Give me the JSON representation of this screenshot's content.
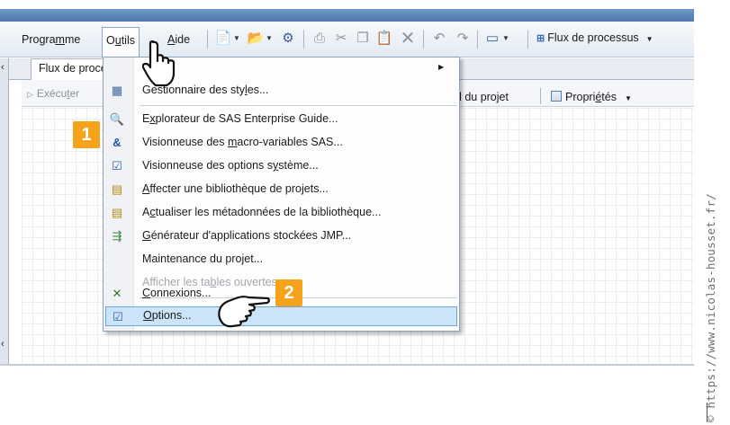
{
  "menubar": {
    "items": [
      {
        "label_pre": "Progra",
        "label_ul": "m",
        "label_post": "me"
      },
      {
        "label_pre": "O",
        "label_ul": "u",
        "label_post": "tils"
      },
      {
        "label_pre": "",
        "label_ul": "A",
        "label_post": "ide"
      }
    ],
    "toolbar_icons": [
      "new-icon",
      "open-icon",
      "sas-server-icon",
      "print-icon",
      "cut-icon",
      "copy-icon",
      "paste-icon",
      "delete-icon",
      "undo-icon",
      "redo-icon",
      "window-layout-icon"
    ],
    "flux_label": "Flux de processus"
  },
  "left_strip": {
    "top_char": "‹",
    "bottom_char": "‹"
  },
  "document_tab": {
    "label": "Flux de proce"
  },
  "doc_toolbar": {
    "run_pre": "Exécu",
    "run_ul": "t",
    "run_post": "er",
    "journal_label": "rnal du projet",
    "props_pre": "Propri",
    "props_ul": "é",
    "props_post": "tés"
  },
  "dropdown": {
    "items": [
      {
        "pre": "Ge",
        "ul": "",
        "post": "stionnaire des sty",
        "ul2": "l",
        "post2": "es...",
        "icon": "style-manager-icon",
        "disabled": false
      },
      {
        "pre": "E",
        "ul": "x",
        "post": "plorateur de SAS Enterprise Guide...",
        "icon": "explorer-icon",
        "disabled": false
      },
      {
        "pre": "Visionneuse des ",
        "ul": "m",
        "post": "acro-variables SAS...",
        "icon": "macro-variables-icon",
        "disabled": false
      },
      {
        "pre": "Visionneuse des options s",
        "ul": "y",
        "post": "stème...",
        "icon": "system-options-icon",
        "disabled": false
      },
      {
        "pre": "",
        "ul": "A",
        "post": "ffecter une bibliothèque de projets...",
        "icon": "assign-library-icon",
        "disabled": false
      },
      {
        "pre": "A",
        "ul": "c",
        "post": "tualiser les métadonnées de la bibliothèque...",
        "icon": "update-metadata-icon",
        "disabled": false
      },
      {
        "pre": "",
        "ul": "G",
        "post": "énérateur d'applications stockées JMP...",
        "icon": "jmp-generator-icon",
        "disabled": false
      },
      {
        "pre": "Maintenance du projet...",
        "ul": "",
        "post": "",
        "icon": "",
        "disabled": false
      },
      {
        "pre": "Afficher les ta",
        "ul": "b",
        "post": "les ouvertes...",
        "icon": "",
        "disabled": true
      },
      {
        "pre": "",
        "ul": "C",
        "post": "onnexions...",
        "icon": "connections-icon",
        "disabled": false
      },
      {
        "pre": "",
        "ul": "O",
        "post": "ptions...",
        "icon": "options-icon",
        "disabled": false
      }
    ]
  },
  "steps": {
    "one": "1",
    "two": "2"
  },
  "watermark": "© https://www.nicolas-housset.fr/"
}
